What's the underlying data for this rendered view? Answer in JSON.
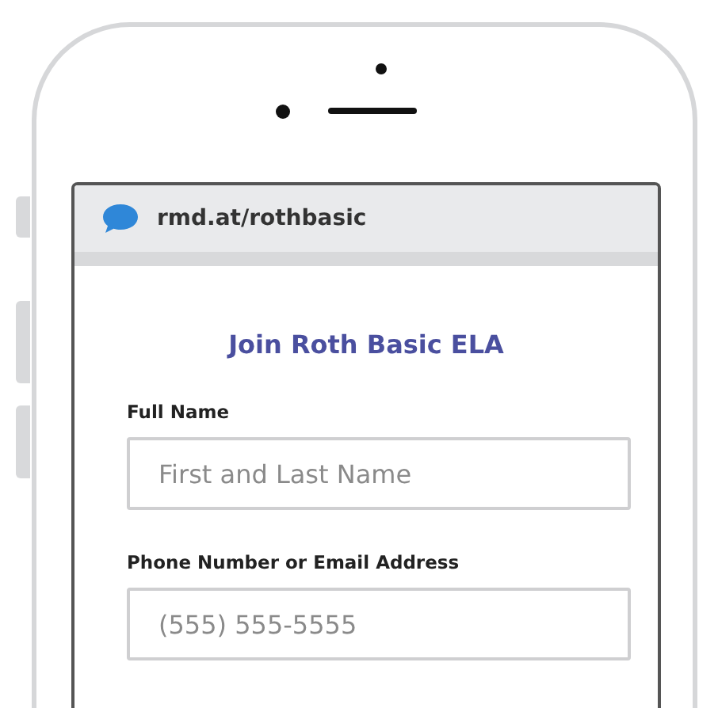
{
  "browser": {
    "url": "rmd.at/rothbasic"
  },
  "form": {
    "title": "Join Roth Basic ELA",
    "fields": [
      {
        "label": "Full Name",
        "placeholder": "First and Last Name"
      },
      {
        "label": "Phone Number or Email Address",
        "placeholder": "(555) 555-5555"
      }
    ]
  }
}
